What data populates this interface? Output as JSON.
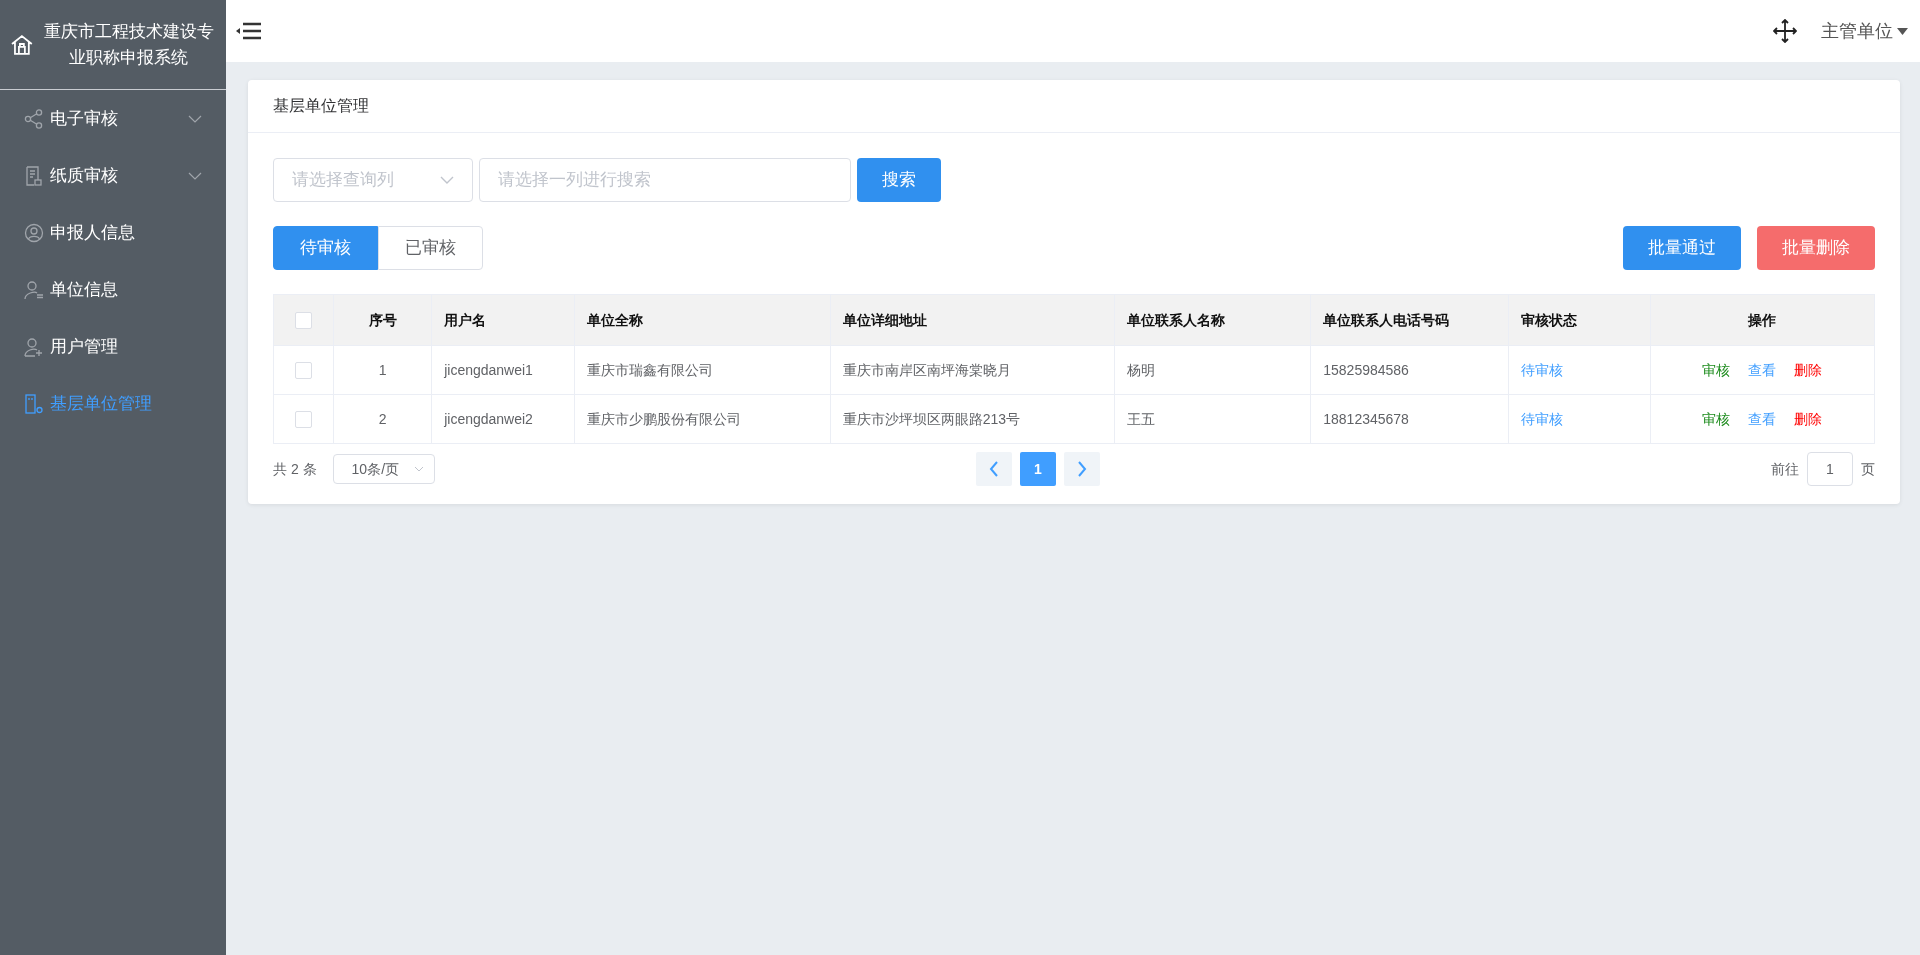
{
  "sidebar": {
    "title": "重庆市工程技术建设专业职称申报系统",
    "items": [
      {
        "label": "电子审核",
        "expanded": false,
        "selected": false
      },
      {
        "label": "纸质审核",
        "expanded": false,
        "selected": false
      },
      {
        "label": "申报人信息",
        "selected": false
      },
      {
        "label": "单位信息",
        "selected": false
      },
      {
        "label": "用户管理",
        "selected": false
      },
      {
        "label": "基层单位管理",
        "selected": true
      }
    ]
  },
  "header": {
    "user": "主管单位"
  },
  "panel": {
    "title": "基层单位管理",
    "search": {
      "column_placeholder": "请选择查询列",
      "placeholder": "请选择一列进行搜索",
      "button": "搜索"
    },
    "tabs": [
      {
        "label": "待审核",
        "selected": true
      },
      {
        "label": "已审核",
        "selected": false
      }
    ],
    "actions": [
      {
        "label": "批量通过",
        "kind": "primary"
      },
      {
        "label": "批量删除",
        "kind": "danger"
      }
    ],
    "table": {
      "columns": [
        "序号",
        "用户名",
        "单位全称",
        "单位详细地址",
        "单位联系人名称",
        "单位联系人电话号码",
        "审核状态",
        "操作"
      ],
      "header_checked": false,
      "rows": [
        {
          "checked": false,
          "cells": [
            "1",
            "jicengdanwei1",
            "重庆市瑞鑫有限公司",
            "重庆市南岸区南坪海棠晓月",
            "杨明",
            "15825984586"
          ],
          "status": "待审核",
          "ops": [
            {
              "label": "审核",
              "kind": "approve"
            },
            {
              "label": "查看",
              "kind": "view"
            },
            {
              "label": "删除",
              "kind": "delete"
            }
          ]
        },
        {
          "checked": false,
          "cells": [
            "2",
            "jicengdanwei2",
            "重庆市少鹏股份有限公司",
            "重庆市沙坪坝区两眼路213号",
            "王五",
            "18812345678"
          ],
          "status": "待审核",
          "ops": [
            {
              "label": "审核",
              "kind": "approve"
            },
            {
              "label": "查看",
              "kind": "view"
            },
            {
              "label": "删除",
              "kind": "delete"
            }
          ]
        }
      ]
    },
    "pagination": {
      "total": "共 2 条",
      "page_size": "10条/页",
      "pages": [
        {
          "label": "1",
          "selected": true
        }
      ],
      "goto_label": "前往",
      "goto_value": "1",
      "goto_suffix": "页"
    }
  }
}
